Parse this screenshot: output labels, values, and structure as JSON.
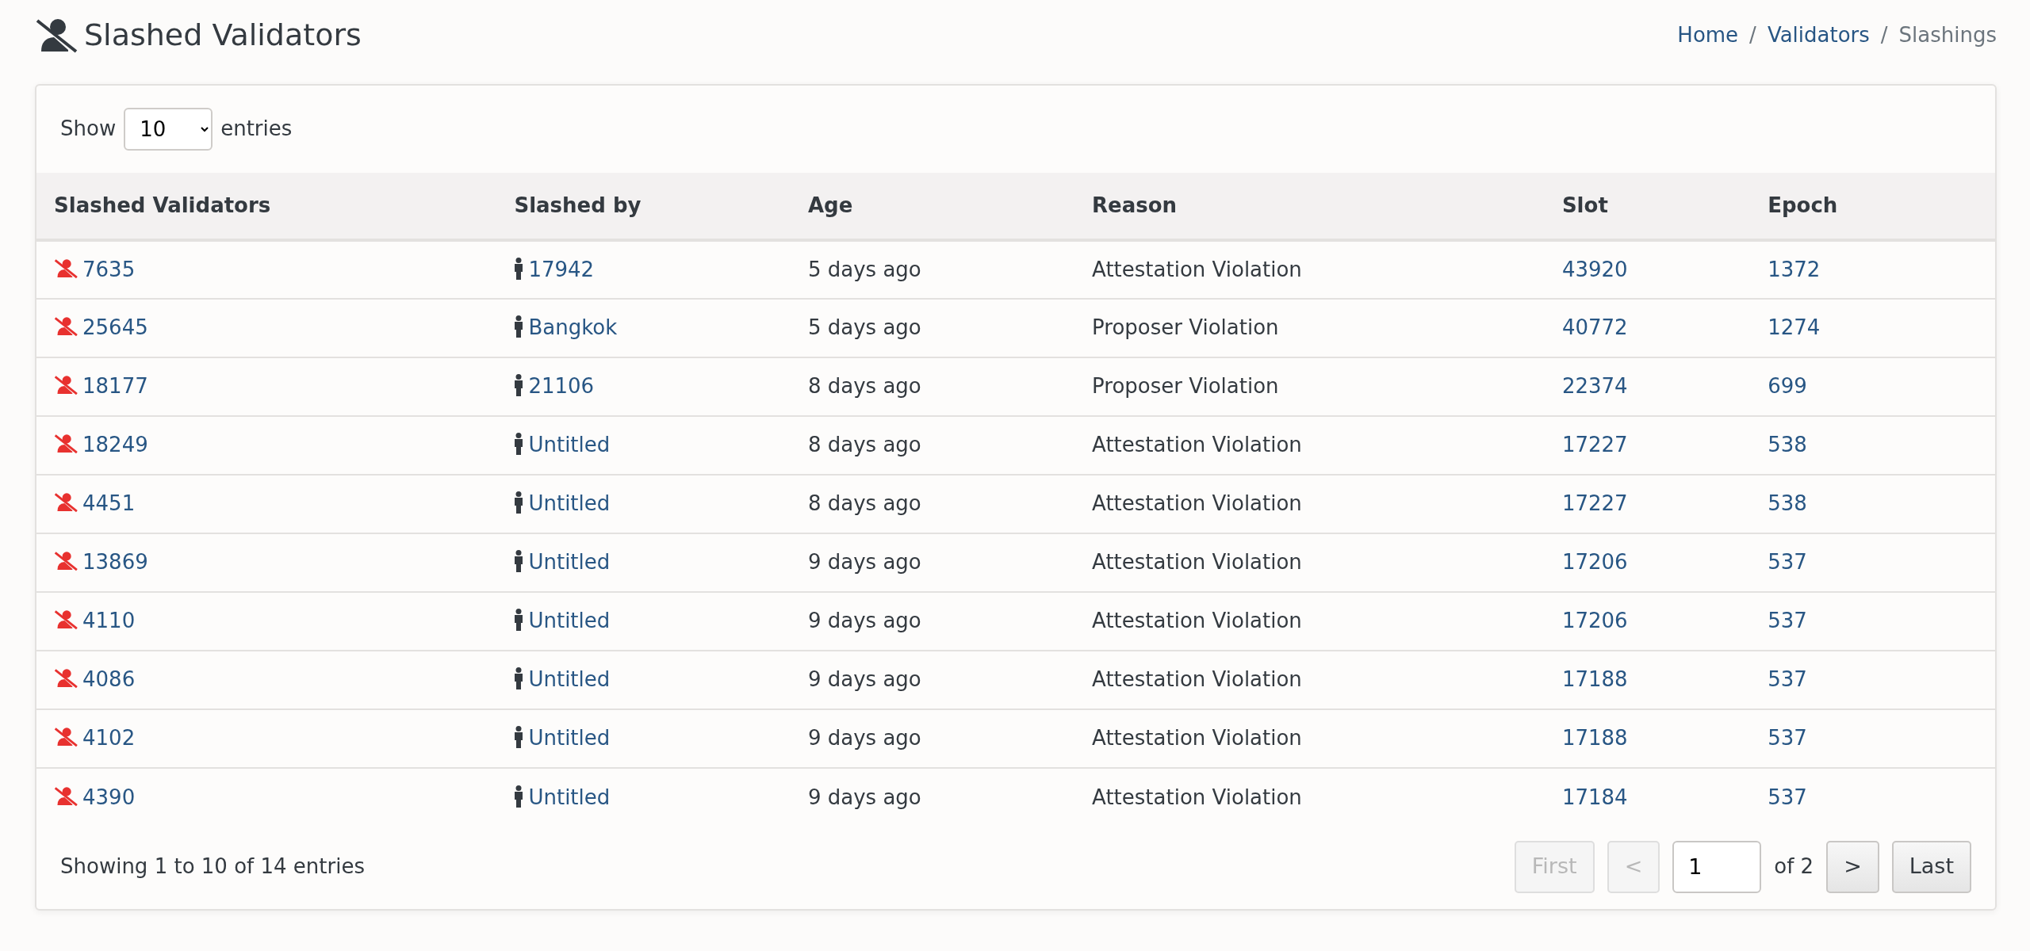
{
  "page_title": "Slashed Validators",
  "breadcrumb": [
    {
      "label": "Home",
      "link": true
    },
    {
      "separator": "/",
      "label": "Validators",
      "link": true
    },
    {
      "separator": "/",
      "label": "Slashings",
      "link": false
    }
  ],
  "length_menu": {
    "before": "Show",
    "value": "10",
    "after": "entries"
  },
  "table": {
    "columns": [
      "Slashed Validators",
      "Slashed by",
      "Age",
      "Reason",
      "Slot",
      "Epoch"
    ],
    "rows": [
      {
        "validator": "7635",
        "slashed_by": "17942",
        "age": "5 days ago",
        "reason": "Attestation Violation",
        "slot": "43920",
        "epoch": "1372"
      },
      {
        "validator": "25645",
        "slashed_by": "Bangkok",
        "age": "5 days ago",
        "reason": "Proposer Violation",
        "slot": "40772",
        "epoch": "1274"
      },
      {
        "validator": "18177",
        "slashed_by": "21106",
        "age": "8 days ago",
        "reason": "Proposer Violation",
        "slot": "22374",
        "epoch": "699"
      },
      {
        "validator": "18249",
        "slashed_by": "Untitled",
        "age": "8 days ago",
        "reason": "Attestation Violation",
        "slot": "17227",
        "epoch": "538"
      },
      {
        "validator": "4451",
        "slashed_by": "Untitled",
        "age": "8 days ago",
        "reason": "Attestation Violation",
        "slot": "17227",
        "epoch": "538"
      },
      {
        "validator": "13869",
        "slashed_by": "Untitled",
        "age": "9 days ago",
        "reason": "Attestation Violation",
        "slot": "17206",
        "epoch": "537"
      },
      {
        "validator": "4110",
        "slashed_by": "Untitled",
        "age": "9 days ago",
        "reason": "Attestation Violation",
        "slot": "17206",
        "epoch": "537"
      },
      {
        "validator": "4086",
        "slashed_by": "Untitled",
        "age": "9 days ago",
        "reason": "Attestation Violation",
        "slot": "17188",
        "epoch": "537"
      },
      {
        "validator": "4102",
        "slashed_by": "Untitled",
        "age": "9 days ago",
        "reason": "Attestation Violation",
        "slot": "17188",
        "epoch": "537"
      },
      {
        "validator": "4390",
        "slashed_by": "Untitled",
        "age": "9 days ago",
        "reason": "Attestation Violation",
        "slot": "17184",
        "epoch": "537"
      }
    ]
  },
  "info": "Showing 1 to 10 of 14 entries",
  "pagination": {
    "first": {
      "label": "First",
      "disabled": true
    },
    "prev": {
      "label": "<",
      "disabled": true
    },
    "page": "1",
    "of": "of 2",
    "next": {
      "label": ">",
      "disabled": false
    },
    "last": {
      "label": "Last",
      "disabled": false
    }
  }
}
